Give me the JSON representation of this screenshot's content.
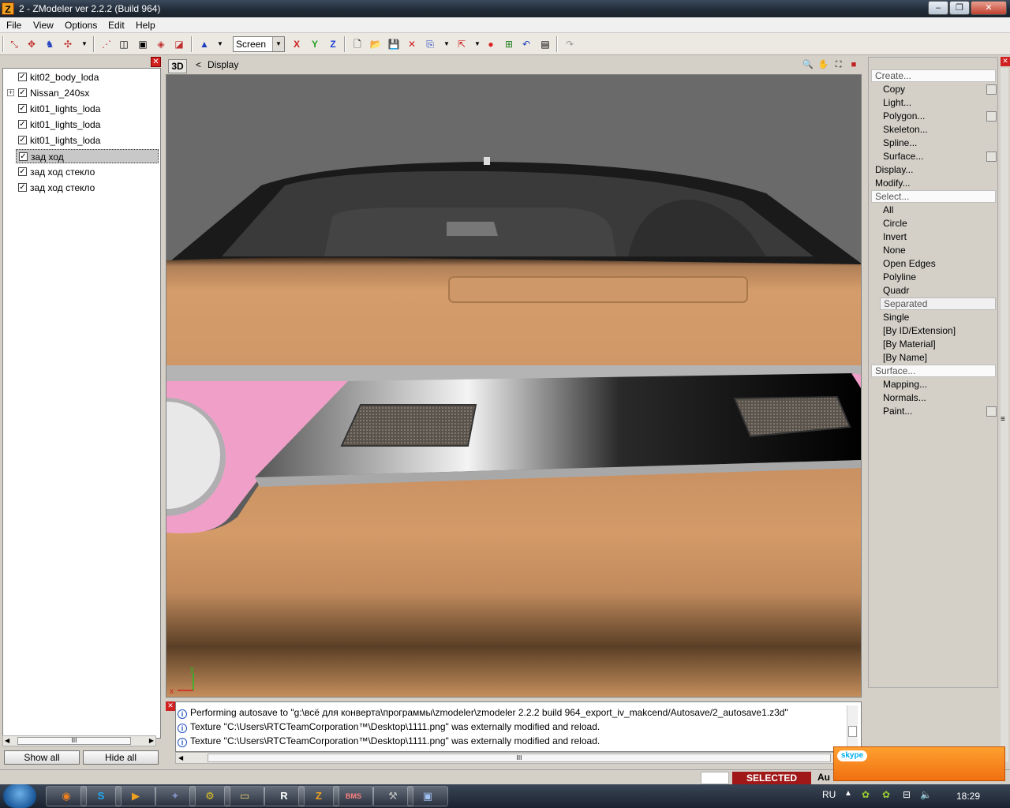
{
  "window": {
    "title": "2 - ZModeler ver 2.2.2 (Build 964)",
    "app_icon": "Z"
  },
  "menu": [
    "File",
    "View",
    "Options",
    "Edit",
    "Help"
  ],
  "toolbar": {
    "view_mode": "Screen",
    "axis_x": "X",
    "axis_y": "Y",
    "axis_z": "Z"
  },
  "tree": {
    "items": [
      {
        "label": "kit02_body_loda",
        "checked": true
      },
      {
        "label": "Nissan_240sx",
        "checked": true,
        "expandable": true
      },
      {
        "label": "kit01_lights_loda",
        "checked": true
      },
      {
        "label": "kit01_lights_loda",
        "checked": true
      },
      {
        "label": "kit01_lights_loda",
        "checked": true
      },
      {
        "label": "зад ход",
        "checked": true,
        "selected": true
      },
      {
        "label": "зад ход стекло",
        "checked": true
      },
      {
        "label": "зад ход стекло",
        "checked": true
      }
    ],
    "show_all": "Show all",
    "hide_all": "Hide all",
    "scroll_grip": "III"
  },
  "viewport": {
    "tab": "3D",
    "back": "<",
    "label": "Display",
    "axis_x": "x",
    "axis_y": "y"
  },
  "commands": {
    "create": "Create...",
    "create_items": [
      "Copy",
      "Light...",
      "Polygon...",
      "Skeleton...",
      "Spline...",
      "Surface..."
    ],
    "display": "Display...",
    "modify": "Modify...",
    "select": "Select...",
    "select_items": [
      "All",
      "Circle",
      "Invert",
      "None",
      "Open Edges",
      "Polyline",
      "Quadr",
      "Separated",
      "Single",
      "[By ID/Extension]",
      "[By Material]",
      "[By Name]"
    ],
    "surface": "Surface...",
    "surface_items": [
      "Mapping...",
      "Normals...",
      "Paint..."
    ]
  },
  "log": {
    "lines": [
      "Performing autosave to \"g:\\всё для конверта\\программы\\zmodeler\\zmodeler 2.2.2 build 964_export_iv_makcend/Autosave/2_autosave1.z3d\"",
      "Texture \"C:\\Users\\RTCTeamCorporation™\\Desktop\\1111.png\" was externally modified and reload.",
      "Texture \"C:\\Users\\RTCTeamCorporation™\\Desktop\\1111.png\" was externally modified and reload."
    ],
    "scroll_grip": "III"
  },
  "status": {
    "mode": "SELECTED MODE",
    "auto": "Au"
  },
  "skype": {
    "logo": "skype"
  },
  "taskbar": {
    "lang": "RU",
    "time": "18:29"
  },
  "colors": {
    "mode_badge": "#a01818",
    "body_paint": "#d09868",
    "accent_pink": "#f0a0c8"
  }
}
